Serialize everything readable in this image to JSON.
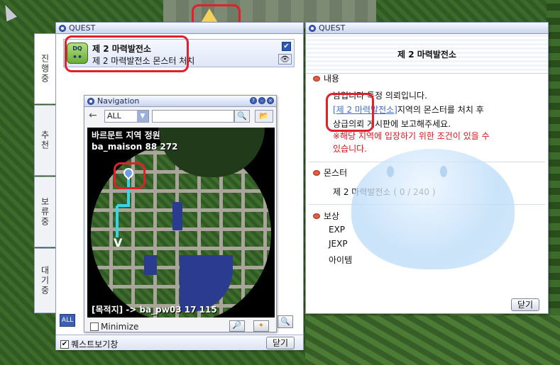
{
  "quest_window": {
    "title": "QUEST",
    "tabs": [
      "진행중",
      "추천",
      "보류중",
      "대기중"
    ],
    "quest_item": {
      "icon_label": "DQ",
      "name": "제 2 마력발전소",
      "subtitle": "제 2 마력발전소 몬스터 처치",
      "checked": true
    },
    "show_quest_label": "퀘스트보기창",
    "show_quest_checked": true,
    "close_label": "닫기",
    "all_label": "ALL"
  },
  "navigation": {
    "title": "Navigation",
    "filter_value": "ALL",
    "search_value": "",
    "map_area": "바르문트 지역 정원",
    "map_coords": "ba_maison 88 272",
    "destination": "[목적지] -> ba_pw03 17 115",
    "minimize_label": "Minimize",
    "minimize_checked": false
  },
  "detail_window": {
    "title": "QUEST",
    "quest_title": "제 2 마력발전소",
    "content_head": "내용",
    "content_lines": [
      "남입니다 특정 의뢰입니다.",
      "지역의 몬스터를 처치 후",
      "상급의뢰 게시판에 보고해주세요."
    ],
    "content_link": "[제 2 마력발전소]",
    "warning_lines": [
      "※해당 지역에 입장하기 위한 조건이 있을 수",
      "있습니다."
    ],
    "monster_head": "몬스터",
    "monster_line": "제 2 마력발전소 ( 0 / 240 )",
    "reward_head": "보상",
    "rewards": [
      "EXP",
      "JEXP",
      "아이템"
    ],
    "close_label": "닫기"
  },
  "colors": {
    "highlight_red": "#e0202a",
    "window_blue": "#3d5fb5",
    "warning_red": "#e2111b",
    "link_blue": "#3b6fd0"
  }
}
